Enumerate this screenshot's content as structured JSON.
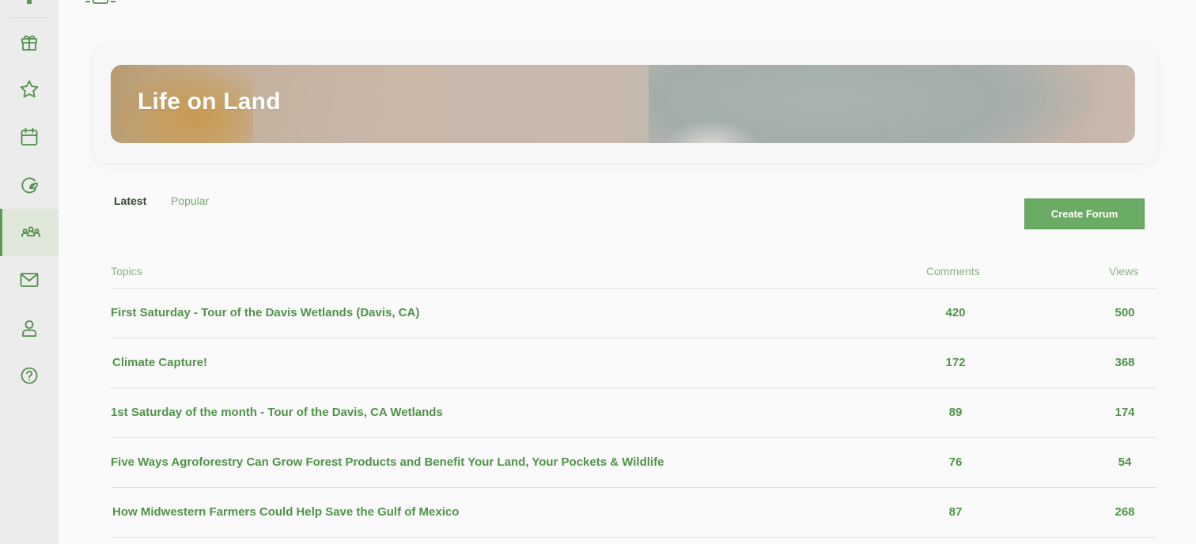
{
  "sidebar": {
    "items": [
      {
        "icon": "gift-icon",
        "name": "sidebar-item-rewards",
        "active": false
      },
      {
        "icon": "star-icon",
        "name": "sidebar-item-favorites",
        "active": false
      },
      {
        "icon": "calendar-icon",
        "name": "sidebar-item-events",
        "active": false
      },
      {
        "icon": "leaf-g-icon",
        "name": "sidebar-item-green",
        "active": false
      },
      {
        "icon": "community-icon",
        "name": "sidebar-item-forums",
        "active": true
      },
      {
        "icon": "mail-icon",
        "name": "sidebar-item-messages",
        "active": false
      },
      {
        "icon": "user-icon",
        "name": "sidebar-item-profile",
        "active": false
      },
      {
        "icon": "help-icon",
        "name": "sidebar-item-help",
        "active": false
      }
    ],
    "accent": "#5a9a52"
  },
  "banner": {
    "title": "Life on Land"
  },
  "tabs": [
    {
      "label": "Latest",
      "active": true
    },
    {
      "label": "Popular",
      "active": false
    }
  ],
  "create_button": {
    "label": "Create Forum"
  },
  "table": {
    "headers": {
      "topics": "Topics",
      "comments": "Comments",
      "views": "Views"
    },
    "rows": [
      {
        "topic": "First Saturday - Tour of the Davis Wetlands (Davis, CA)",
        "comments": "420",
        "views": "500"
      },
      {
        "topic": "Climate Capture!",
        "comments": "172",
        "views": "368"
      },
      {
        "topic": "1st Saturday of the month - Tour of the Davis, CA Wetlands",
        "comments": "89",
        "views": "174"
      },
      {
        "topic": "Five Ways Agroforestry Can Grow Forest Products and Benefit Your Land, Your Pockets & Wildlife",
        "comments": "76",
        "views": "54"
      },
      {
        "topic": "How Midwestern Farmers Could Help Save the Gulf of Mexico",
        "comments": "87",
        "views": "268"
      }
    ]
  },
  "colors": {
    "primary_green": "#4f9348",
    "button_green": "#6aac64",
    "header_green": "#8bb286"
  }
}
